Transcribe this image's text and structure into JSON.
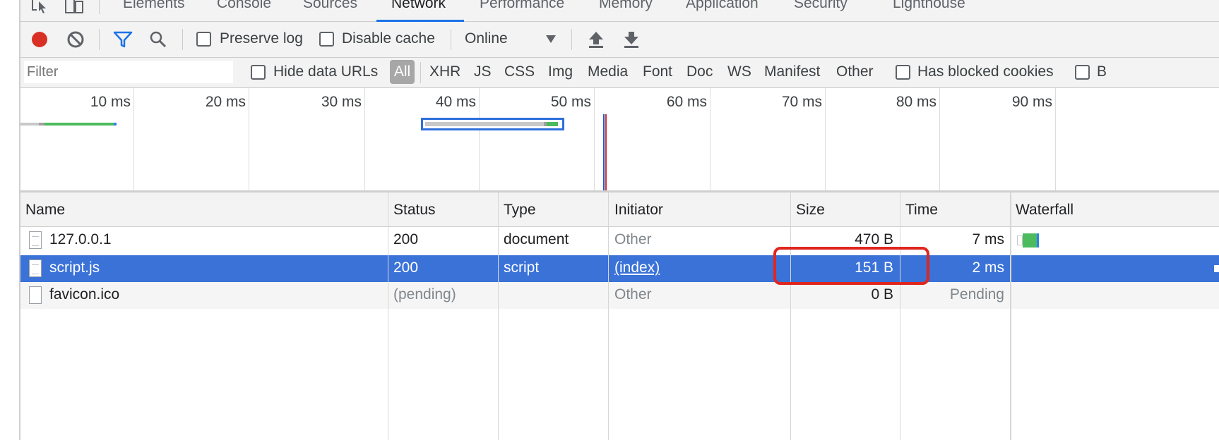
{
  "tabs": [
    {
      "label": "Elements",
      "active": false
    },
    {
      "label": "Console",
      "active": false
    },
    {
      "label": "Sources",
      "active": false
    },
    {
      "label": "Network",
      "active": true
    },
    {
      "label": "Performance",
      "active": false
    },
    {
      "label": "Memory",
      "active": false
    },
    {
      "label": "Application",
      "active": false
    },
    {
      "label": "Security",
      "active": false
    },
    {
      "label": "Lighthouse",
      "active": false
    }
  ],
  "toolbar": {
    "preserve_log": "Preserve log",
    "disable_cache": "Disable cache",
    "throttle_value": "Online",
    "record_color": "#d93025",
    "accent": "#1a73e8"
  },
  "filter": {
    "placeholder": "Filter",
    "hide_data_urls": "Hide data URLs",
    "types": [
      "All",
      "XHR",
      "JS",
      "CSS",
      "Img",
      "Media",
      "Font",
      "Doc",
      "WS",
      "Manifest",
      "Other"
    ],
    "active_type": "All",
    "has_blocked_cookies": "Has blocked cookies",
    "truncated_checkbox": "B"
  },
  "overview": {
    "ticks": [
      "10 ms",
      "20 ms",
      "30 ms",
      "40 ms",
      "50 ms",
      "60 ms",
      "70 ms",
      "80 ms",
      "90 ms"
    ]
  },
  "table": {
    "columns": [
      "Name",
      "Status",
      "Type",
      "Initiator",
      "Size",
      "Time",
      "Waterfall"
    ],
    "rows": [
      {
        "name": "127.0.0.1",
        "status": "200",
        "type": "document",
        "initiator": "Other",
        "size": "470 B",
        "time": "7 ms",
        "selected": false
      },
      {
        "name": "script.js",
        "status": "200",
        "type": "script",
        "initiator": "(index)",
        "size": "151 B",
        "time": "2 ms",
        "selected": true
      },
      {
        "name": "favicon.ico",
        "status": "(pending)",
        "type": "",
        "initiator": "Other",
        "size": "0 B",
        "time": "Pending",
        "selected": false
      }
    ]
  },
  "colors": {
    "selection": "#3a72d8",
    "highlight": "#e0261e",
    "waterfall_green": "#4cbb5e",
    "waterfall_blue": "#2f80ed"
  }
}
